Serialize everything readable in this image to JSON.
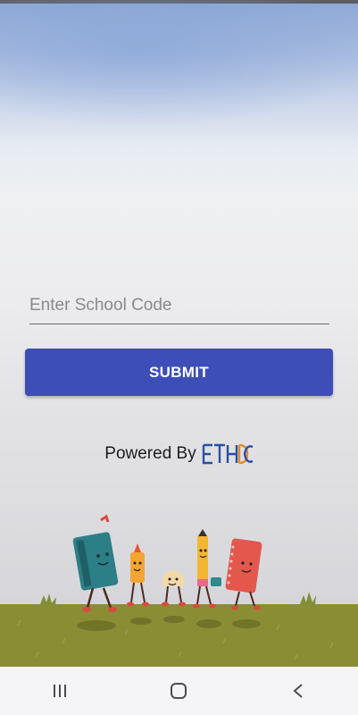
{
  "form": {
    "school_code_placeholder": "Enter School Code",
    "school_code_value": "",
    "submit_label": "SUBMIT"
  },
  "footer": {
    "powered_by": "Powered By",
    "brand_logo": "ETHDC"
  },
  "navigation": {
    "recents_icon": "recents-icon",
    "home_icon": "home-icon",
    "back_icon": "back-icon"
  },
  "colors": {
    "primary_button": "#3d4eb8",
    "grass": "#8b8d35",
    "logo_blue": "#2a4fa3",
    "logo_orange": "#e58a2a"
  }
}
